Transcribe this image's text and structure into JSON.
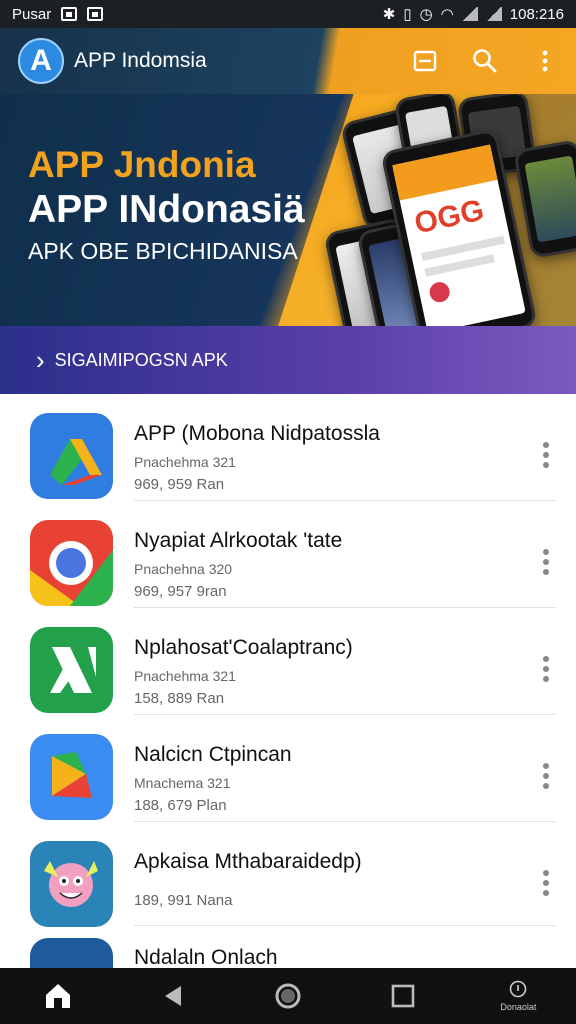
{
  "status_bar": {
    "carrier": "Pusar",
    "time": "108:216"
  },
  "app_bar": {
    "title": "APP Indomsia",
    "logo_letter": "A",
    "icons": [
      "window-icon",
      "search-icon",
      "more-vert-icon"
    ]
  },
  "banner": {
    "title_orange": "APP Jndonia",
    "title_white": "APP INdonasiä",
    "subtitle": "APK OBE BPICHIDANISA",
    "phone_screen_text": "OGG",
    "cta_label": "SIGAIMIPOGSN APK"
  },
  "apps": [
    {
      "name": "APP (Mobona Nidpatossla",
      "meta": "Pnachehma 321",
      "size": "969, 959 Ran",
      "icon": "drive-icon"
    },
    {
      "name": "Nyapiat Alrkootak 'tate",
      "meta": "Pnachehna 320",
      "size": "969, 957 9ran",
      "icon": "chrome-icon"
    },
    {
      "name": "Nplahosat'Coalaptranc)",
      "meta": "Pnachehma 321",
      "size": "158, 889 Ran",
      "icon": "x-app-icon"
    },
    {
      "name": "Nalcicn Ctpincan",
      "meta": "Mnachema 321",
      "size": "188, 679 Plan",
      "icon": "play-icon"
    },
    {
      "name": "Apkaisa Mthabaraidedp)",
      "meta": "",
      "size": "189, 991 Nana",
      "icon": "monster-game-icon"
    },
    {
      "name": "Ndalaln Onlach",
      "meta": "",
      "size": "",
      "icon": "app-icon"
    }
  ],
  "nav_bar": {
    "download_label": "Donaolat",
    "icons": [
      "home-icon",
      "back-icon",
      "home-circle-icon",
      "recents-icon",
      "download-icon"
    ]
  },
  "colors": {
    "accent_orange": "#f5a623",
    "appbar_navy": "#17324a",
    "cta_purple": "#5a3fa8"
  }
}
